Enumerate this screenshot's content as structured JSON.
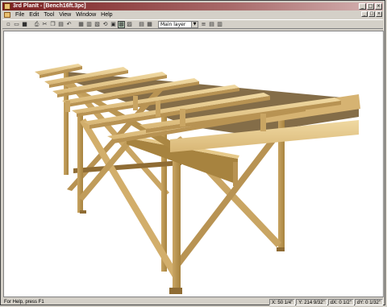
{
  "window": {
    "title": "3rd PlanIt - [Bench16ft.3pc]"
  },
  "menu": [
    "File",
    "Edit",
    "Tool",
    "View",
    "Window",
    "Help"
  ],
  "toolbar": {
    "icons": [
      "new-icon",
      "open-icon",
      "save-icon",
      "sep",
      "print-icon",
      "cut-icon",
      "copy-icon",
      "paste-icon",
      "undo-icon",
      "sep",
      "select-icon",
      "zoom-icon",
      "pan-icon",
      "rotate-icon",
      "wire-icon",
      "solid-icon",
      "render-icon",
      "sep",
      "grid-icon",
      "snap-icon",
      "sep",
      "layer-icon"
    ],
    "layer_value": "Main layer"
  },
  "status": {
    "help": "For Help, press F1",
    "x": "X: 50 1/4\"",
    "y": "Y: 214 9/32\"",
    "dx": "dX: 0 1/2\"",
    "dy": "dY: 0 1/32\""
  },
  "colors": {
    "wood_top": "#e6c98a",
    "wood_side": "#c9a563",
    "wood_dark": "#8f6c34",
    "title_start": "#7a2020"
  }
}
